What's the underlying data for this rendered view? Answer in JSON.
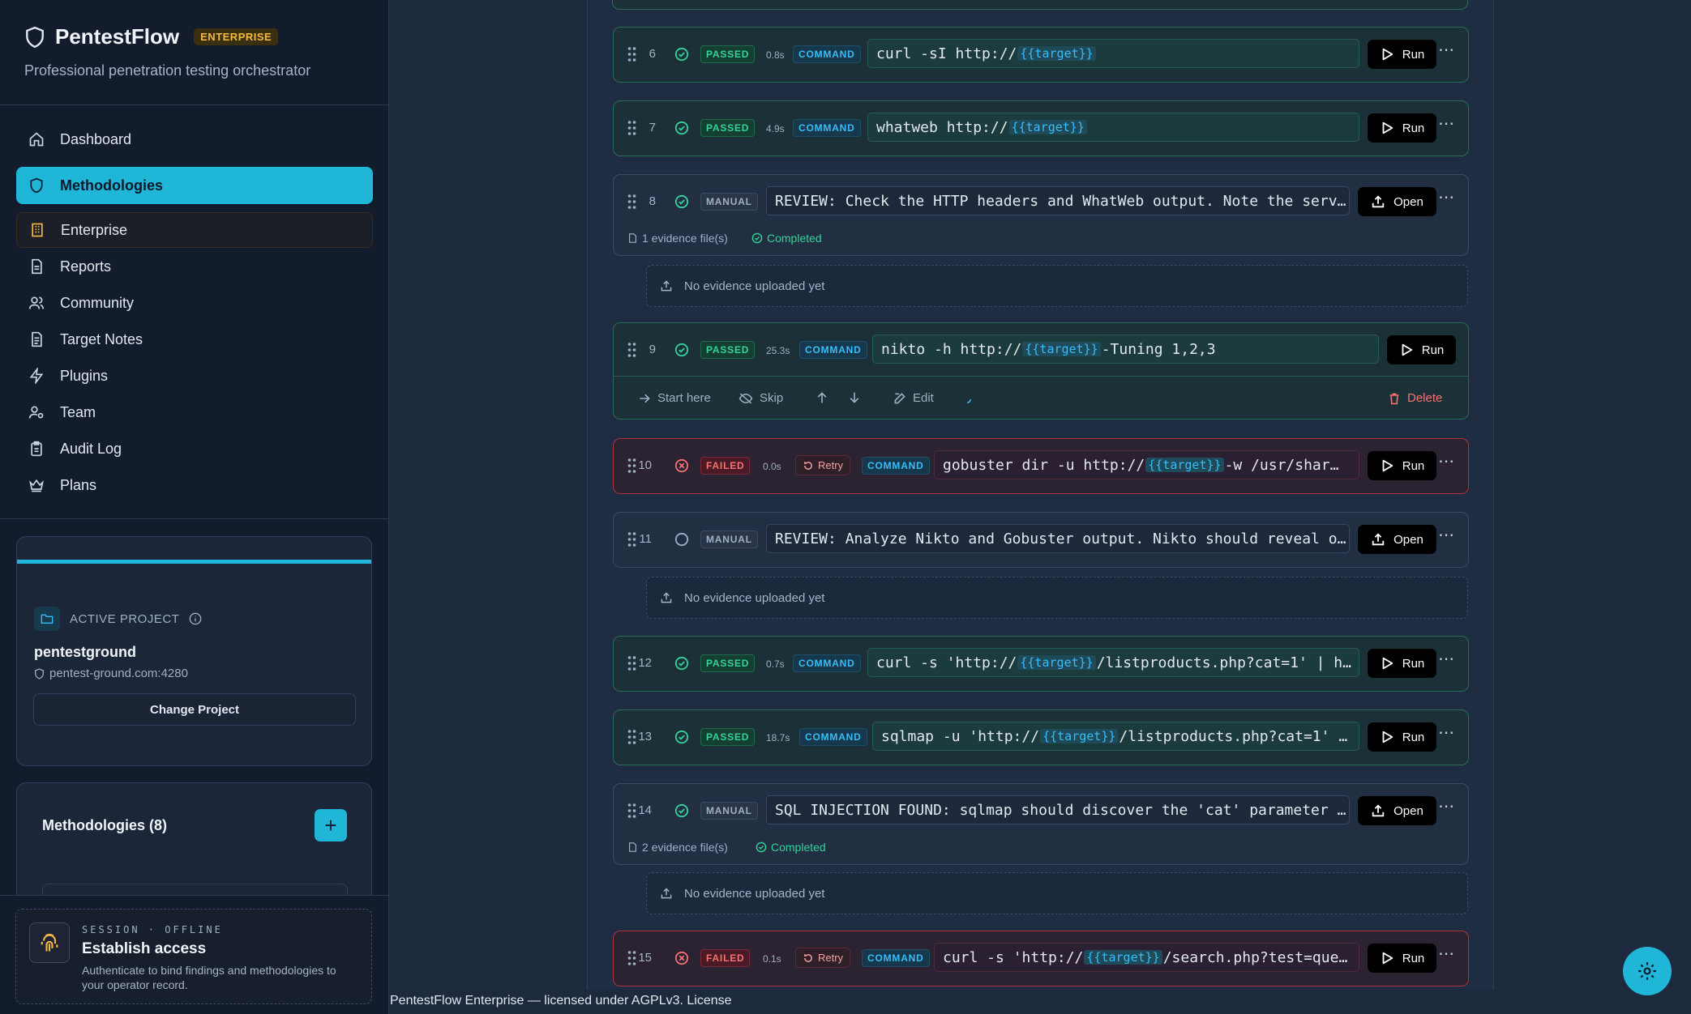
{
  "app": {
    "title": "PentestFlow",
    "badge": "ENTERPRISE",
    "subtitle": "Professional penetration testing orchestrator"
  },
  "nav": [
    {
      "label": "Dashboard",
      "icon": "home-icon"
    },
    {
      "label": "Methodologies",
      "icon": "shield-icon"
    },
    {
      "label": "Enterprise",
      "icon": "building-icon"
    },
    {
      "label": "Reports",
      "icon": "file-icon"
    },
    {
      "label": "Community",
      "icon": "users-icon"
    },
    {
      "label": "Target Notes",
      "icon": "notes-icon"
    },
    {
      "label": "Plugins",
      "icon": "bolt-icon"
    },
    {
      "label": "Team",
      "icon": "team-icon"
    },
    {
      "label": "Audit Log",
      "icon": "clipboard-icon"
    },
    {
      "label": "Plans",
      "icon": "crown-icon"
    }
  ],
  "project": {
    "label": "ACTIVE PROJECT",
    "name": "pentestground",
    "host": "pentest-ground.com:4280",
    "change": "Change Project"
  },
  "methodologies": {
    "title": "Methodologies (8)",
    "add": "+"
  },
  "session": {
    "kicker": "SESSION · OFFLINE",
    "title": "Establish access",
    "desc": "Authenticate to bind findings and methodologies to your operator record."
  },
  "steps": [
    {
      "num": "6",
      "status": "PASSED",
      "duration": "0.8s",
      "type": "COMMAND",
      "cmd_pre": "curl -sI http://",
      "cmd_target": "{{target}}",
      "cmd_post": "",
      "action": "Run"
    },
    {
      "num": "7",
      "status": "PASSED",
      "duration": "4.9s",
      "type": "COMMAND",
      "cmd_pre": "whatweb http://",
      "cmd_target": "{{target}}",
      "cmd_post": "",
      "action": "Run"
    },
    {
      "num": "8",
      "status": "MANUAL",
      "text": "REVIEW: Check the HTTP headers and WhatWeb output. Note the serve…",
      "action": "Open",
      "evidence": "1 evidence file(s)",
      "completed": "Completed",
      "no_evidence": "No evidence uploaded yet"
    },
    {
      "num": "9",
      "status": "PASSED",
      "duration": "25.3s",
      "type": "COMMAND",
      "cmd_pre": "nikto -h http://",
      "cmd_target": "{{target}}",
      "cmd_post": " -Tuning 1,2,3",
      "action": "Run",
      "actions": {
        "start": "Start here",
        "skip": "Skip",
        "edit": "Edit",
        "delete": "Delete"
      }
    },
    {
      "num": "10",
      "status": "FAILED",
      "duration": "0.0s",
      "retry": "Retry",
      "type": "COMMAND",
      "cmd_pre": "gobuster dir -u http://",
      "cmd_target": "{{target}}",
      "cmd_post": " -w /usr/shar…",
      "action": "Run"
    },
    {
      "num": "11",
      "status": "MANUAL",
      "text": "REVIEW: Analyze Nikto and Gobuster output. Nikto should reveal ou…",
      "action": "Open",
      "no_evidence": "No evidence uploaded yet"
    },
    {
      "num": "12",
      "status": "PASSED",
      "duration": "0.7s",
      "type": "COMMAND",
      "cmd_pre": "curl -s 'http://",
      "cmd_target": "{{target}}",
      "cmd_post": "/listproducts.php?cat=1' | h…",
      "action": "Run"
    },
    {
      "num": "13",
      "status": "PASSED",
      "duration": "18.7s",
      "type": "COMMAND",
      "cmd_pre": "sqlmap -u 'http://",
      "cmd_target": "{{target}}",
      "cmd_post": "/listproducts.php?cat=1' …",
      "action": "Run"
    },
    {
      "num": "14",
      "status": "MANUAL",
      "text": "SQL INJECTION FOUND: sqlmap should discover the 'cat' parameter i…",
      "action": "Open",
      "evidence": "2 evidence file(s)",
      "completed": "Completed",
      "no_evidence": "No evidence uploaded yet"
    },
    {
      "num": "15",
      "status": "FAILED",
      "duration": "0.1s",
      "retry": "Retry",
      "type": "COMMAND",
      "cmd_pre": "curl -s 'http://",
      "cmd_target": "{{target}}",
      "cmd_post": "/search.php?test=que…",
      "action": "Run"
    }
  ],
  "footer": "PentestFlow Enterprise — licensed under AGPLv3. License",
  "colors": {
    "accent": "#1fb6d8",
    "passed": "#34d399",
    "failed": "#f87171",
    "enterprise": "#f5b942"
  }
}
